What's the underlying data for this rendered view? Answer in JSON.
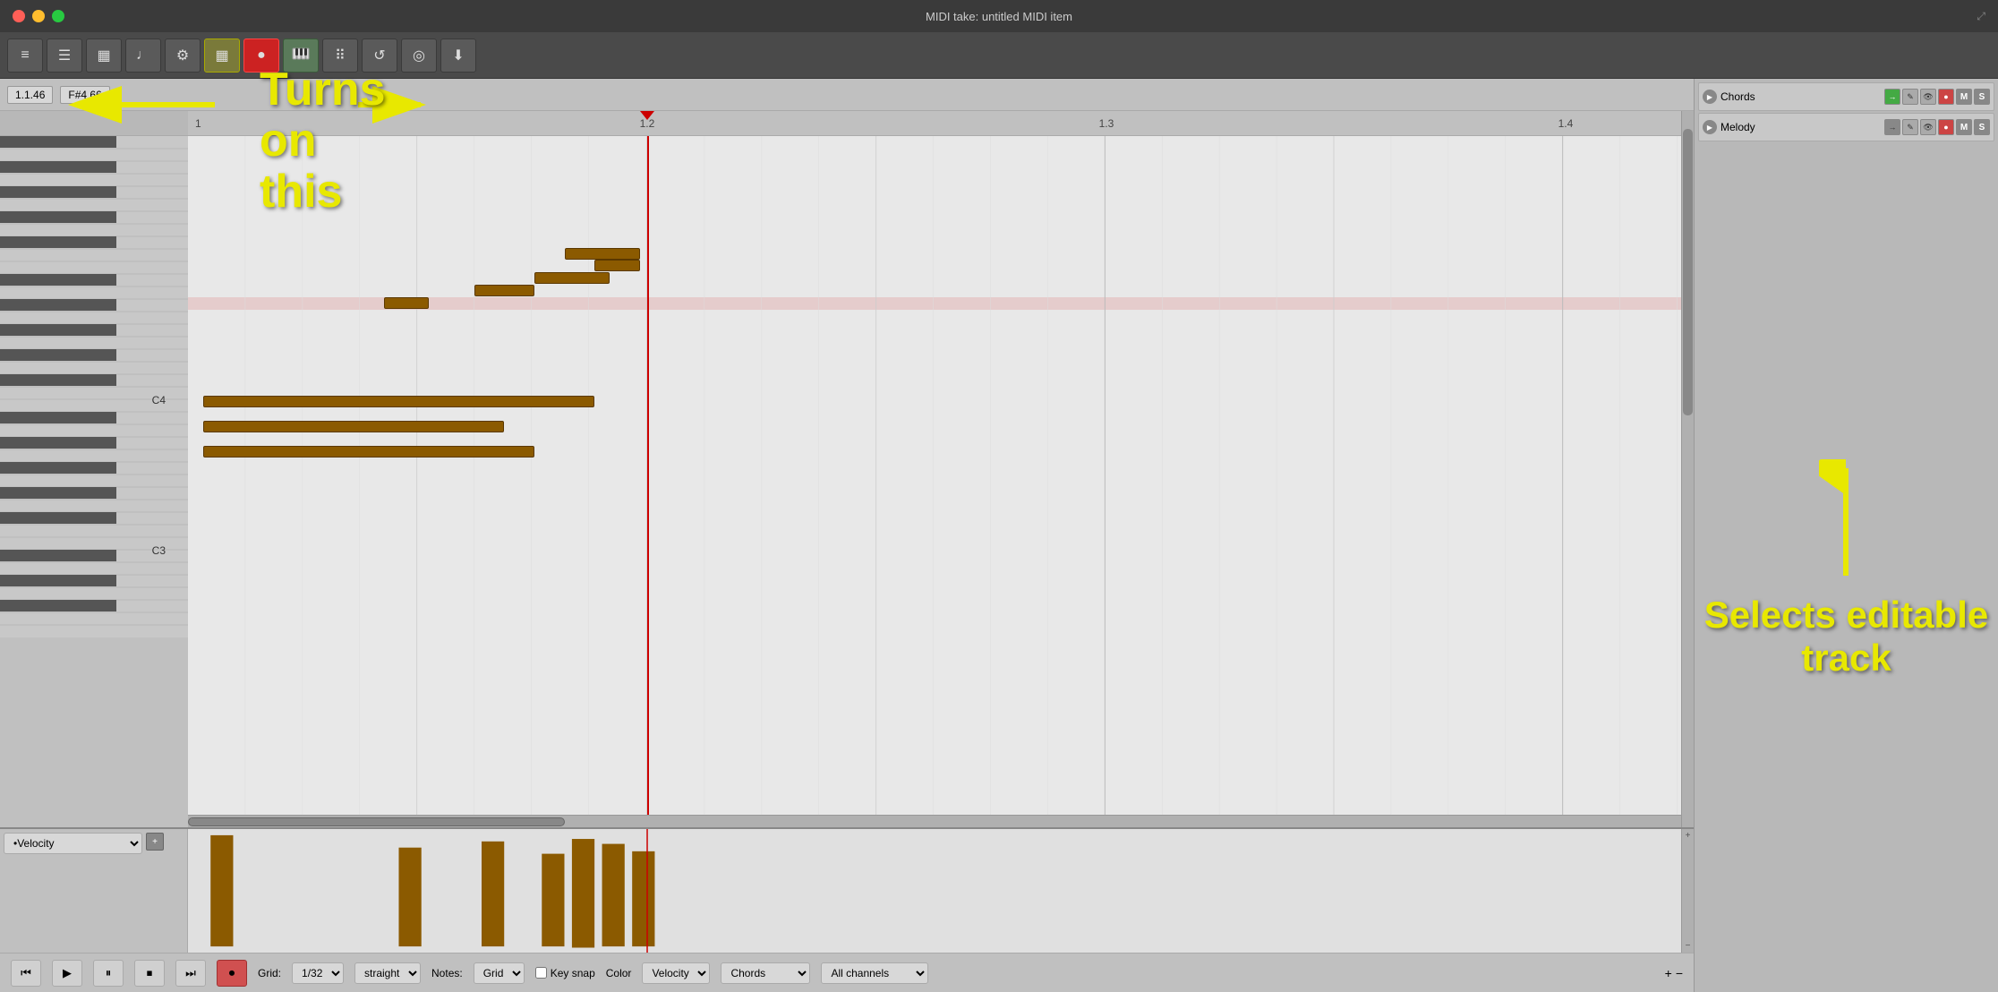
{
  "window": {
    "title": "MIDI take: untitled MIDI item"
  },
  "info_bar": {
    "position": "1.1.46",
    "note": "F#4  66"
  },
  "ruler": {
    "markers": [
      {
        "label": "1",
        "pos_pct": 0
      },
      {
        "label": "1.2",
        "pos_pct": 30.5
      },
      {
        "label": "1.3",
        "pos_pct": 61
      },
      {
        "label": "1.4",
        "pos_pct": 91.5
      }
    ]
  },
  "annotations": {
    "turns_on_this": "Turns on this",
    "selects_track": "Selects editable\ntrack"
  },
  "tracks": [
    {
      "name": "Chords",
      "play": true,
      "controls": [
        "arrow-right",
        "pencil",
        "eye",
        "dot",
        "M",
        "S"
      ]
    },
    {
      "name": "Melody",
      "play": true,
      "controls": [
        "arrow-right",
        "pencil",
        "eye",
        "dot",
        "M",
        "S"
      ]
    }
  ],
  "bottom_toolbar": {
    "transport": [
      "prev",
      "play",
      "pause",
      "stop",
      "next",
      "record"
    ],
    "grid_label": "Grid:",
    "grid_value": "1/32",
    "curve_label": "straight",
    "notes_label": "Notes:",
    "notes_value": "Grid",
    "key_snap_label": "Key snap",
    "color_label": "Color",
    "color_value": "Velocity",
    "chords_label": "Chords",
    "channels_label": "All channels",
    "velocity_label": "•Velocity"
  },
  "piano_keys": {
    "c4_label": "C4",
    "c3_label": "C3"
  },
  "playhead_pos_pct": 30.5
}
